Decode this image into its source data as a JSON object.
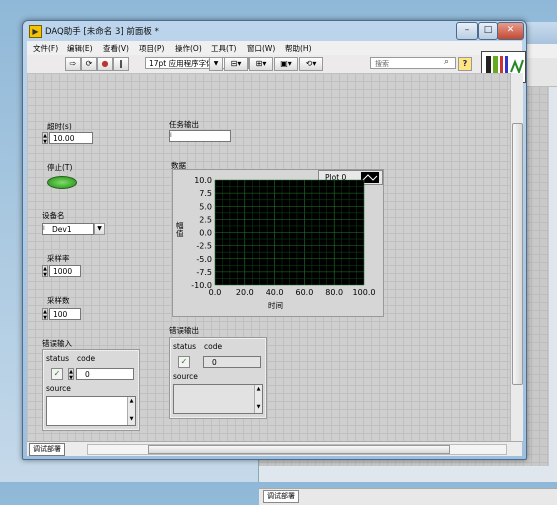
{
  "background_window": {
    "context_tab": "调试部署"
  },
  "window": {
    "title": "DAQ助手 [未命名 3] 前面板 *"
  },
  "menu": [
    "文件(F)",
    "编辑(E)",
    "查看(V)",
    "项目(P)",
    "操作(O)",
    "工具(T)",
    "窗口(W)",
    "帮助(H)"
  ],
  "toolbar": {
    "font": "17pt 应用程序字体",
    "search_placeholder": "搜索",
    "help": "?"
  },
  "controls": {
    "timeout": {
      "label": "超时(s)",
      "value": "10.00"
    },
    "stop": {
      "label": "停止(T)"
    },
    "device": {
      "label": "设备名",
      "value": "Dev1"
    },
    "sample_rate": {
      "label": "采样率",
      "value": "1000"
    },
    "samples": {
      "label": "采样数",
      "value": "100"
    },
    "task_out": {
      "label": "任务输出",
      "value": ""
    }
  },
  "error_in": {
    "label": "错误输入",
    "status": "status",
    "code": "code",
    "code_value": "0",
    "source": "source"
  },
  "error_out": {
    "label": "错误输出",
    "status": "status",
    "code": "code",
    "code_value": "0",
    "source": "source"
  },
  "status_bar": {
    "context_tab": "调试部署"
  },
  "chart_data": {
    "type": "line",
    "title": "数据",
    "xlabel": "时间",
    "ylabel": "幅值",
    "xlim": [
      0,
      100
    ],
    "ylim": [
      -10,
      10
    ],
    "x_ticks": [
      "0.0",
      "20.0",
      "40.0",
      "60.0",
      "80.0",
      "100.0"
    ],
    "y_ticks": [
      "10.0",
      "7.5",
      "5.0",
      "2.5",
      "0.0",
      "-2.5",
      "-5.0",
      "-7.5",
      "-10.0"
    ],
    "legend": "Plot 0",
    "grid": true,
    "series": []
  }
}
